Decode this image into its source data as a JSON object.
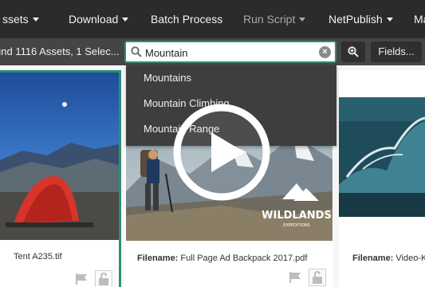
{
  "topnav": {
    "items": [
      {
        "label": "ssets",
        "caret": true,
        "dim": false
      },
      {
        "label": "Download",
        "caret": true,
        "dim": false
      },
      {
        "label": "Batch Process",
        "caret": false,
        "dim": false
      },
      {
        "label": "Run Script",
        "caret": true,
        "dim": true
      },
      {
        "label": "NetPublish",
        "caret": true,
        "dim": false
      },
      {
        "label": "Ma",
        "caret": false,
        "dim": false
      }
    ]
  },
  "toolbar": {
    "result_text": "und 1116 Assets, 1 Selec...",
    "search": {
      "value": "Mountain",
      "placeholder": ""
    },
    "fields_label": "Fields..."
  },
  "suggestions": [
    "Mountains",
    "Mountain Climbing",
    "Mountain Range"
  ],
  "cards": [
    {
      "filename_label": "",
      "filename_value": "Tent A235.tif",
      "selected": true
    },
    {
      "filename_label": "Filename:",
      "filename_value": "Full Page Ad Backpack 2017.pdf",
      "selected": false
    },
    {
      "filename_label": "Filename:",
      "filename_value": "Video-K",
      "selected": false
    }
  ],
  "wildlands_logo": {
    "title": "WILDLANDS",
    "subtitle": "EXPEDITIONS"
  },
  "colors": {
    "accent": "#2f8f6f",
    "nav_bg": "#2b2b2b",
    "toolbar_bg": "#454545",
    "dropdown_bg": "#3e3e3e"
  }
}
